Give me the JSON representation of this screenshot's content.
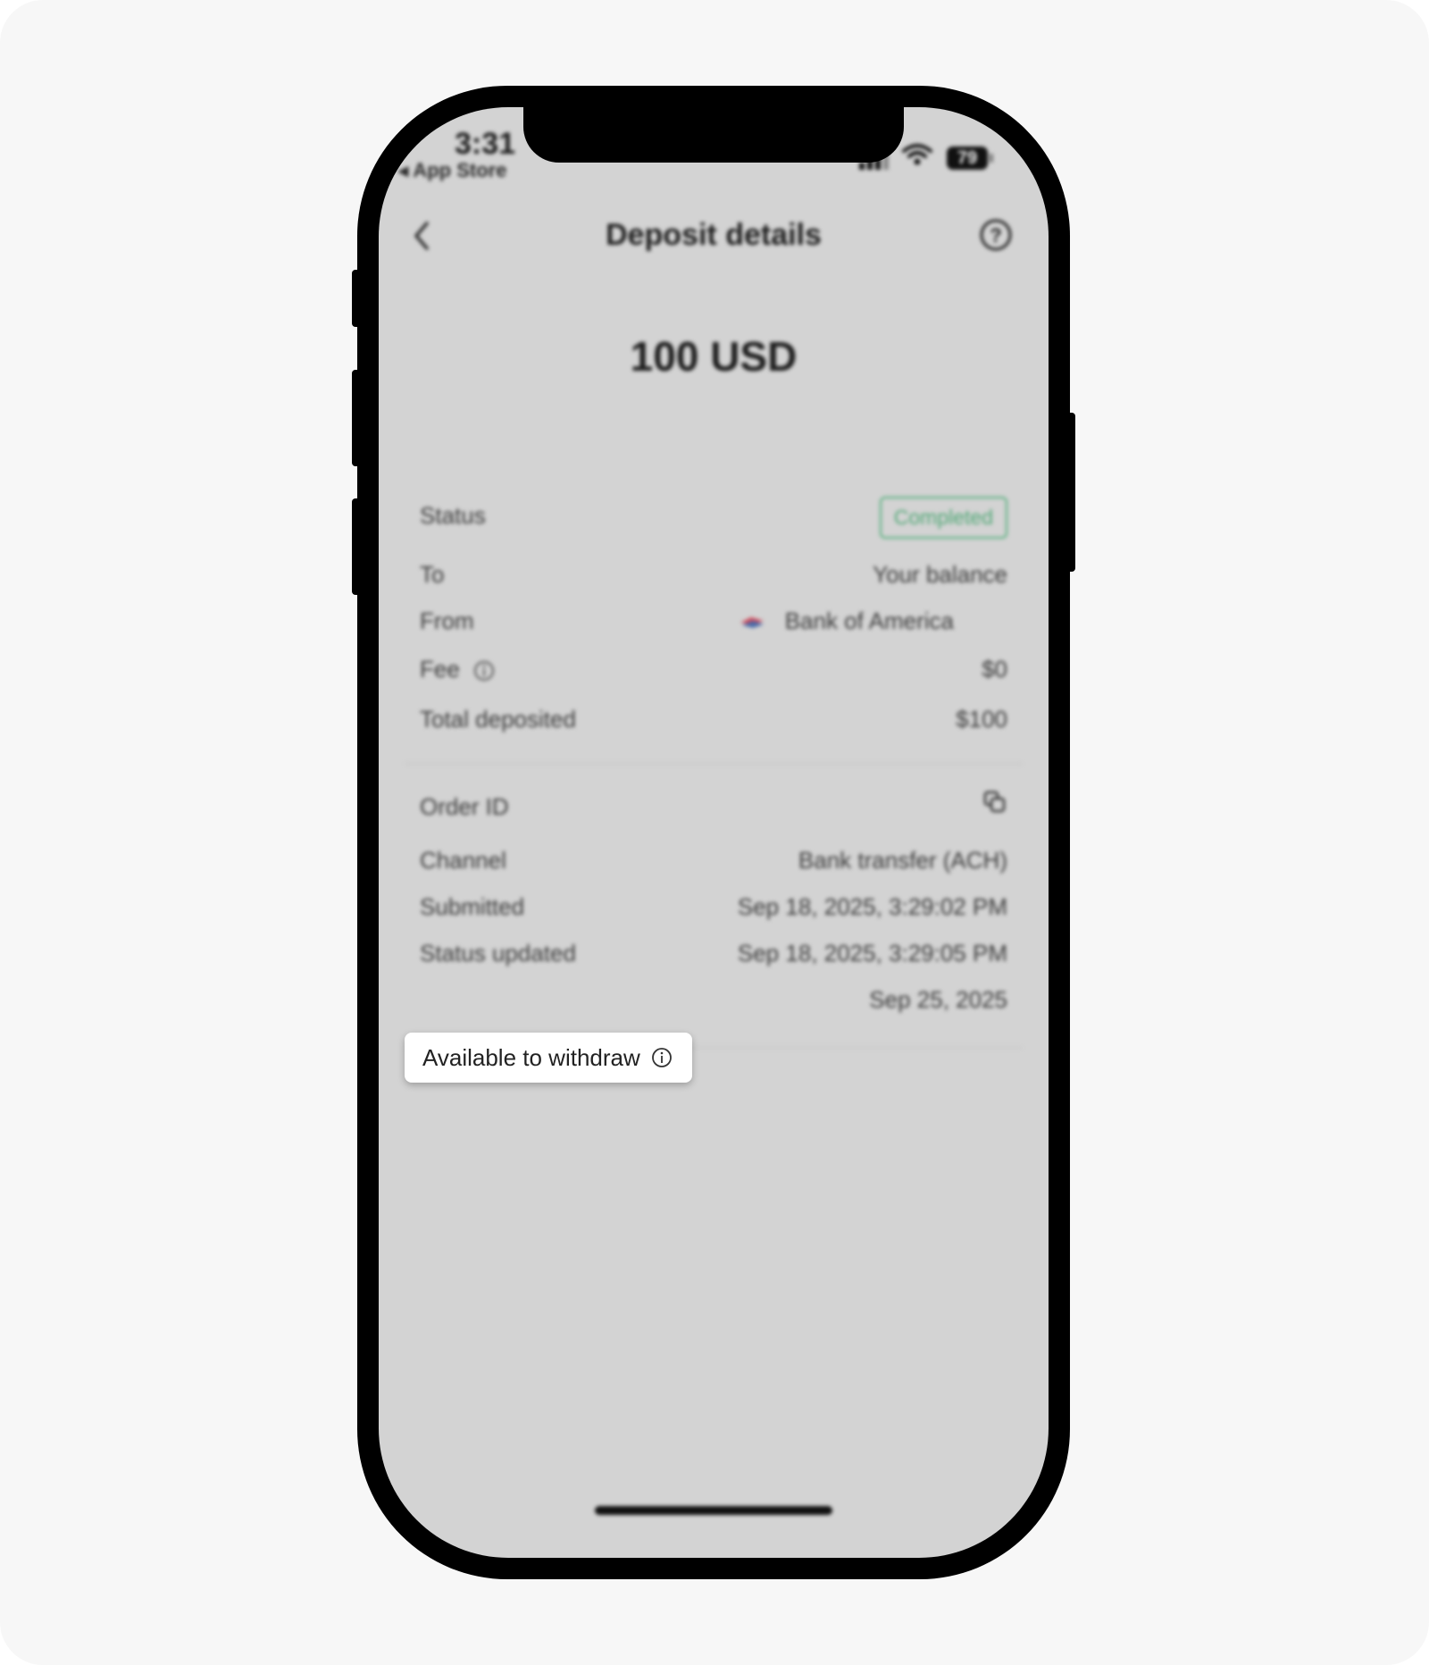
{
  "status_bar": {
    "time": "3:31",
    "back_app": "◂ App Store",
    "battery": "79"
  },
  "nav": {
    "title": "Deposit details"
  },
  "amount": "100 USD",
  "details": {
    "status_label": "Status",
    "status_value": "Completed",
    "to_label": "To",
    "to_value": "Your balance",
    "from_label": "From",
    "from_value": "Bank of America",
    "fee_label": "Fee",
    "fee_value": "$0",
    "total_label": "Total deposited",
    "total_value": "$100"
  },
  "order": {
    "order_id_label": "Order ID",
    "channel_label": "Channel",
    "channel_value": "Bank transfer (ACH)",
    "submitted_label": "Submitted",
    "submitted_value": "Sep 18, 2025, 3:29:02 PM",
    "updated_label": "Status updated",
    "updated_value": "Sep 18, 2025, 3:29:05 PM",
    "available_label": "Available to withdraw",
    "available_value": "Sep 25, 2025"
  },
  "colors": {
    "completed_green": "#4fa775",
    "screen_bg": "#d3d3d3"
  }
}
